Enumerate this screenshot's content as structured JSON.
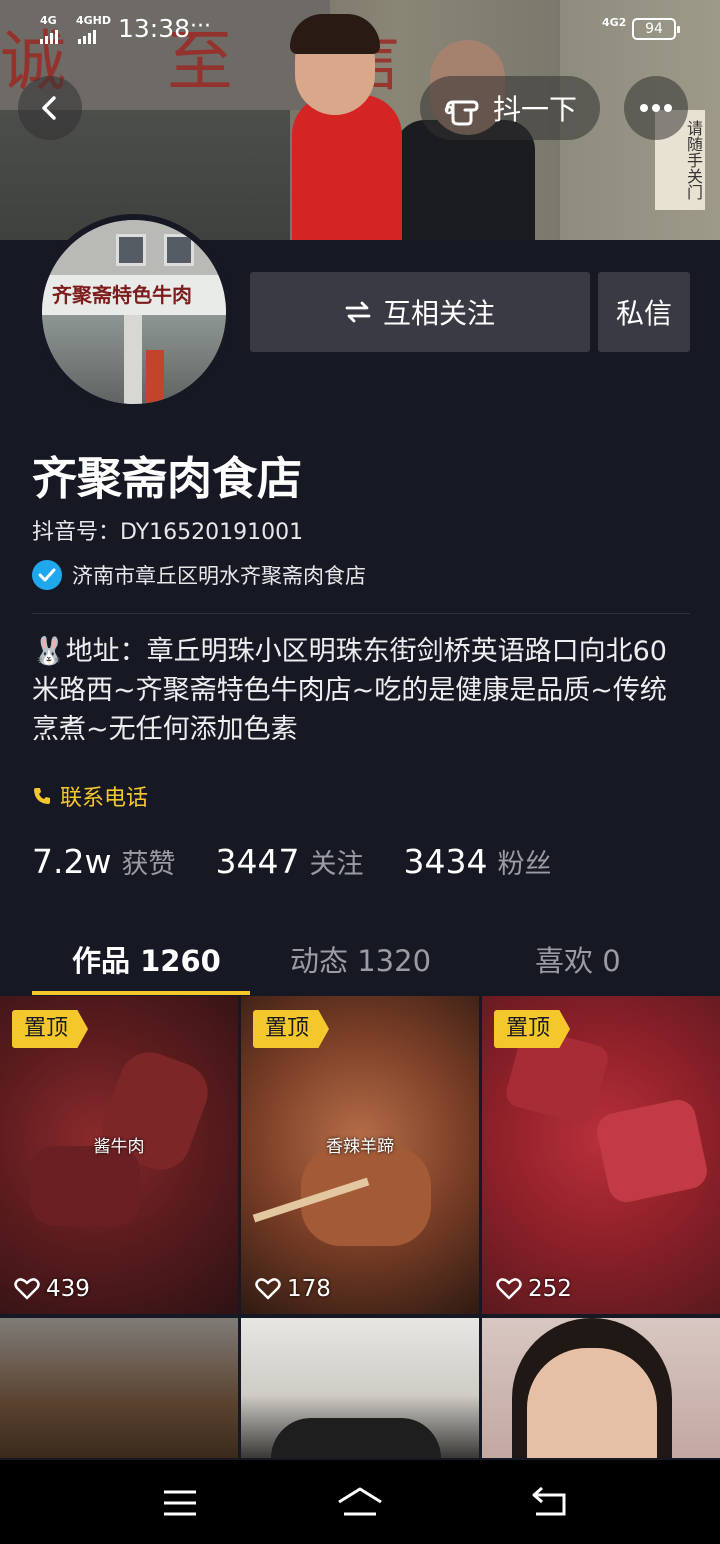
{
  "status_bar": {
    "signal_left_1": "4G",
    "signal_left_2": "4GHD",
    "time": "13:38",
    "more": "···",
    "signal_right": "4G2",
    "battery": "94"
  },
  "cover": {
    "banner_text": "诚 至 信",
    "door_sign": "请随手关门"
  },
  "header_actions": {
    "back_icon": "chevron-left-icon",
    "shake_label": "抖一下",
    "more_icon": "more-horizontal-icon"
  },
  "avatar": {
    "shop_sign": "齐聚斋特色牛肉"
  },
  "actions": {
    "follow_label": "互相关注",
    "message_label": "私信"
  },
  "profile": {
    "name": "齐聚斋肉食店",
    "douyin_id": "抖音号：DY16520191001",
    "verified_text": "济南市章丘区明水齐聚斋肉食店",
    "bio": "🐰地址：章丘明珠小区明珠东街剑桥英语路口向北60米路西~齐聚斋特色牛肉店~吃的是健康是品质~传统烹煮~无任何添加色素",
    "phone_label": "联系电话"
  },
  "stats": [
    {
      "num": "7.2w",
      "label": "获赞"
    },
    {
      "num": "3447",
      "label": "关注"
    },
    {
      "num": "3434",
      "label": "粉丝"
    }
  ],
  "tabs": [
    {
      "label": "作品 1260"
    },
    {
      "label": "动态 1320"
    },
    {
      "label": "喜欢 0"
    }
  ],
  "videos": [
    {
      "pin": "置顶",
      "caption": "酱牛肉",
      "likes": "439"
    },
    {
      "pin": "置顶",
      "caption": "香辣羊蹄",
      "likes": "178"
    },
    {
      "pin": "置顶",
      "caption": "",
      "likes": "252"
    },
    {
      "pin": "",
      "caption": "",
      "likes": ""
    },
    {
      "pin": "",
      "caption": "",
      "likes": ""
    },
    {
      "pin": "",
      "caption": "",
      "likes": ""
    }
  ],
  "colors": {
    "background": "#161823",
    "accent": "#f4c82c",
    "verified": "#20a8ec",
    "button": "#3a3a44"
  }
}
